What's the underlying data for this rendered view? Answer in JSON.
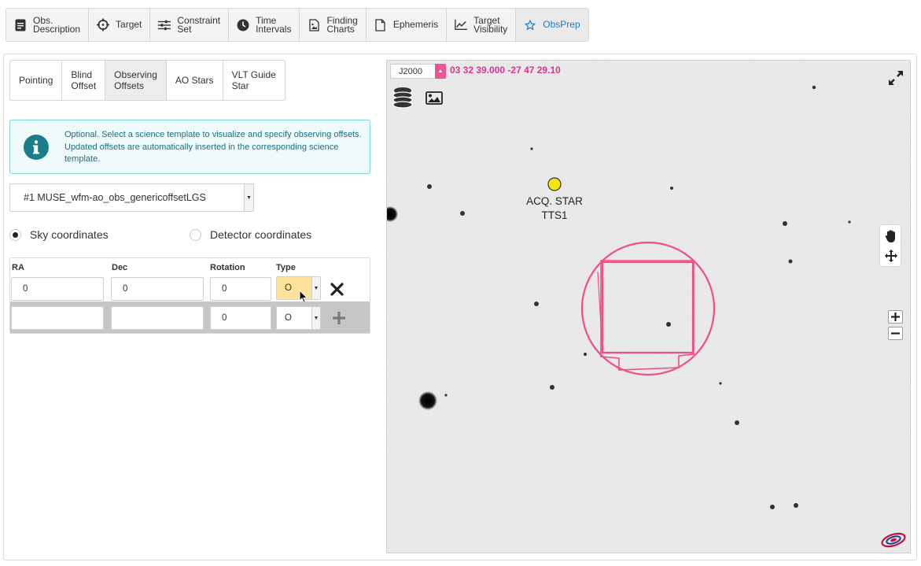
{
  "top_tabs": [
    {
      "label": "Obs.\nDescription",
      "icon": "document-icon"
    },
    {
      "label": "Target",
      "icon": "crosshair-icon"
    },
    {
      "label": "Constraint\nSet",
      "icon": "sliders-icon"
    },
    {
      "label": "Time\nIntervals",
      "icon": "clock-icon"
    },
    {
      "label": "Finding\nCharts",
      "icon": "file-image-icon"
    },
    {
      "label": "Ephemeris",
      "icon": "file-icon"
    },
    {
      "label": "Target\nVisibility",
      "icon": "line-chart-icon"
    },
    {
      "label": "ObsPrep",
      "icon": "star-icon",
      "active": true
    }
  ],
  "sub_tabs": [
    {
      "label": "Pointing"
    },
    {
      "label": "Blind\nOffset"
    },
    {
      "label": "Observing\nOffsets",
      "active": true
    },
    {
      "label": "AO Stars"
    },
    {
      "label": "VLT Guide\nStar"
    }
  ],
  "info": {
    "text": "Optional. Select a science template to visualize and specify observing offsets. Updated offsets are automatically inserted in the corresponding science template."
  },
  "template_select": {
    "value": "#1 MUSE_wfm-ao_obs_genericoffsetLGS"
  },
  "coordinate_mode": {
    "sky_label": "Sky coordinates",
    "detector_label": "Detector coordinates",
    "selected": "sky"
  },
  "offsets_table": {
    "headers": {
      "ra": "RA",
      "dec": "Dec",
      "rotation": "Rotation",
      "type": "Type"
    },
    "rows": [
      {
        "ra": "0",
        "dec": "0",
        "rotation": "0",
        "type": "O"
      },
      {
        "ra": "",
        "dec": "",
        "rotation": "0",
        "type": "O"
      }
    ]
  },
  "viewer": {
    "frame": "J2000",
    "coordinates": "03 32 39.000 -27 47 29.10",
    "acq_star_label": "ACQ. STAR",
    "acq_star_name": "TTS1"
  },
  "colors": {
    "accent": "#1a7cc9",
    "fov_overlay": "#ef4f86",
    "coords_text": "#e0338f",
    "info_bg": "#effafb",
    "info_text": "#1b6e84",
    "acq_star": "#f5e512",
    "highlight_select": "#fde29b"
  }
}
